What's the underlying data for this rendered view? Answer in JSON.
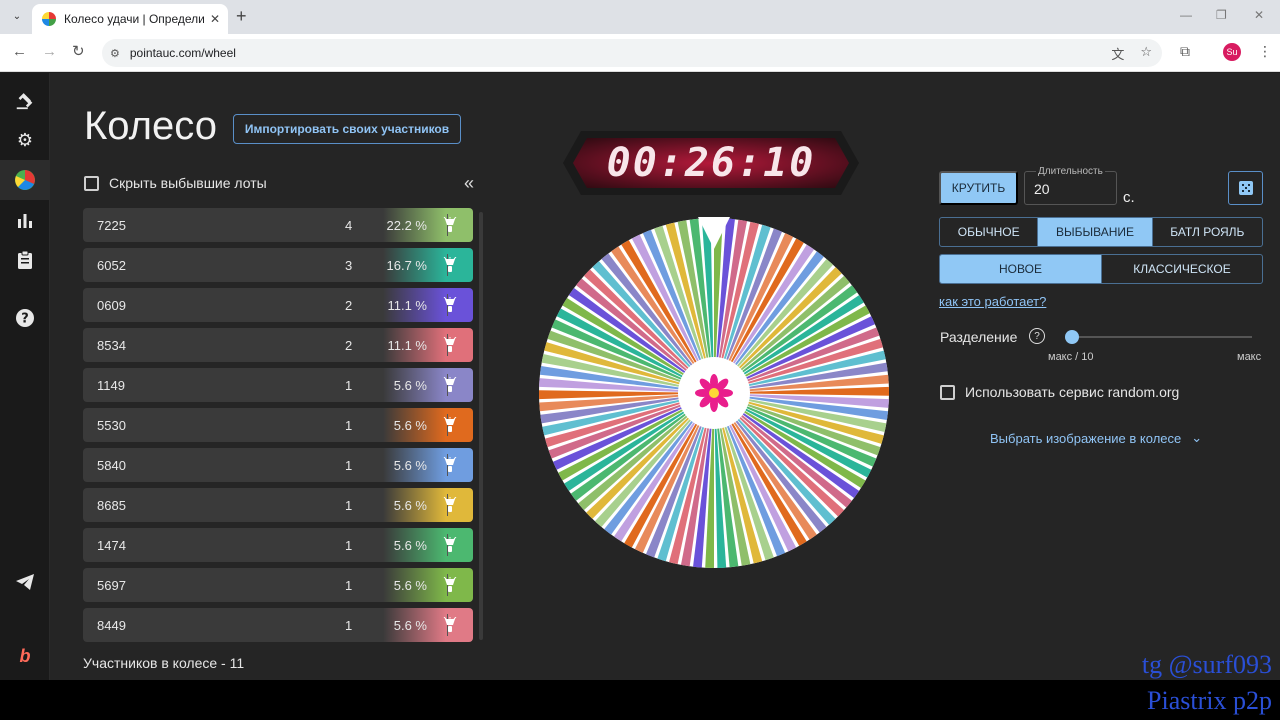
{
  "browser": {
    "tab_title": "Колесо удачи | Определите по",
    "url": "pointauc.com/wheel",
    "profile_initials": "Su"
  },
  "page": {
    "title": "Колесо",
    "import_button": "Импортировать своих участников",
    "hide_label": "Скрыть выбывшие лоты",
    "participants_label": "Участников в колесе - 11"
  },
  "lots": [
    {
      "name": "7225",
      "count": "4",
      "pct": "22.2 %",
      "color": "#8fbf6a"
    },
    {
      "name": "6052",
      "count": "3",
      "pct": "16.7 %",
      "color": "#2bb59a"
    },
    {
      "name": "0609",
      "count": "2",
      "pct": "11.1 %",
      "color": "#6a52d9"
    },
    {
      "name": "8534",
      "count": "2",
      "pct": "11.1 %",
      "color": "#e0707a"
    },
    {
      "name": "1149",
      "count": "1",
      "pct": "5.6 %",
      "color": "#8a86c8"
    },
    {
      "name": "5530",
      "count": "1",
      "pct": "5.6 %",
      "color": "#e06a1e"
    },
    {
      "name": "5840",
      "count": "1",
      "pct": "5.6 %",
      "color": "#6f9de0"
    },
    {
      "name": "8685",
      "count": "1",
      "pct": "5.6 %",
      "color": "#e0b83a"
    },
    {
      "name": "1474",
      "count": "1",
      "pct": "5.6 %",
      "color": "#4cb870"
    },
    {
      "name": "5697",
      "count": "1",
      "pct": "5.6 %",
      "color": "#7fb84a"
    },
    {
      "name": "8449",
      "count": "1",
      "pct": "5.6 %",
      "color": "#e07a86"
    }
  ],
  "timer": "00:26:10",
  "controls": {
    "spin_button": "КРУТИТЬ",
    "duration_label": "Длительность",
    "duration_value": "20",
    "duration_unit": "с.",
    "modes": [
      "ОБЫЧНОЕ",
      "ВЫБЫВАНИЕ",
      "БАТЛ РОЯЛЬ"
    ],
    "active_mode": "ВЫБЫВАНИЕ",
    "variants": [
      "НОВОЕ",
      "КЛАССИЧЕСКОЕ"
    ],
    "active_variant": "НОВОЕ",
    "how_link": "как это работает?",
    "split_label": "Разделение",
    "split_min": "макс / 10",
    "split_max": "макс",
    "random_label": "Использовать сервис random.org",
    "choose_image": "Выбрать изображение в колесе"
  },
  "wheel_colors": [
    "#7fb84a",
    "#4cb870",
    "#e0b83a",
    "#6f9de0",
    "#e06a1e",
    "#8a86c8",
    "#e0707a",
    "#6a52d9",
    "#2bb59a",
    "#8fbf6a",
    "#a8d08d",
    "#c0a0e0",
    "#e88a5a",
    "#5fbfd0",
    "#d06a8a"
  ],
  "watermark": {
    "line1": "tg @surf093",
    "line2": "Piastrix p2p"
  }
}
